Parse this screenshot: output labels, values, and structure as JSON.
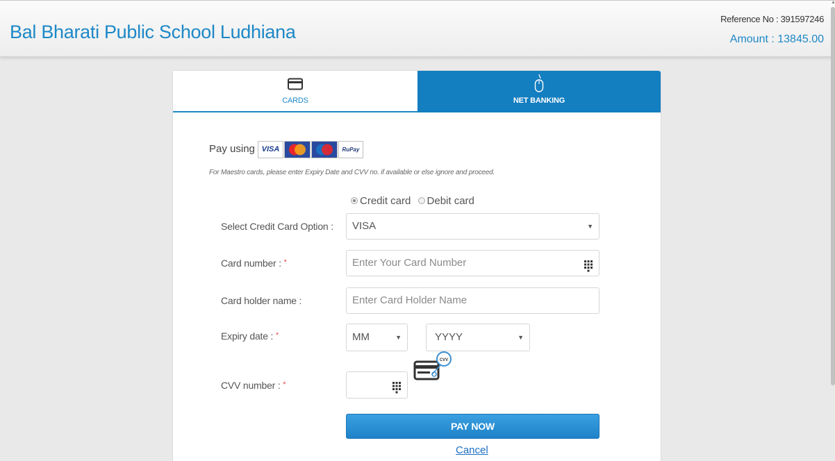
{
  "header": {
    "school_name": "Bal Bharati Public School Ludhiana",
    "reference": "Reference No : 391597246",
    "amount": "Amount : 13845.00"
  },
  "tabs": [
    {
      "label": "CARDS",
      "icon": "card-icon",
      "active": true
    },
    {
      "label": "NET BANKING",
      "icon": "mouse-icon",
      "active": false
    }
  ],
  "payment": {
    "pay_using_label": "Pay using",
    "logos": [
      {
        "name": "VISA",
        "icon": "visa-logo"
      },
      {
        "name": "MasterCard",
        "icon": "mastercard-logo"
      },
      {
        "name": "Maestro",
        "icon": "maestro-logo"
      },
      {
        "name": "RuPay",
        "icon": "rupay-logo"
      }
    ],
    "note": "For Maestro cards, please enter Expiry Date and CVV no. if available or else ignore and proceed."
  },
  "card_type": {
    "options": [
      {
        "label": "Credit card",
        "checked": true
      },
      {
        "label": "Debit card",
        "checked": false
      }
    ]
  },
  "form": {
    "select_option_label": "Select Credit Card Option :",
    "select_option_value": "VISA",
    "card_number_label": "Card number :",
    "card_number_placeholder": "Enter Your Card Number",
    "holder_name_label": "Card holder name :",
    "holder_name_placeholder": "Enter Card Holder Name",
    "expiry_label": "Expiry date :",
    "expiry_month": "MM",
    "expiry_year": "YYYY",
    "cvv_label": "CVV number :",
    "cvv_badge": "CVV",
    "required_mark": "*"
  },
  "actions": {
    "pay_now": "PAY NOW",
    "cancel": "Cancel"
  },
  "colors": {
    "brand_blue": "#1d88c7",
    "tab_active_bg": "#137ec0",
    "button_blue": "#2a8fd4",
    "required_red": "#e24b4b"
  }
}
